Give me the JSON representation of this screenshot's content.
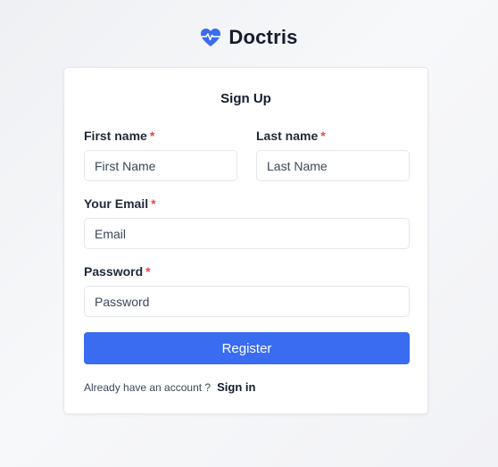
{
  "brand": {
    "name": "Doctris",
    "color": "#396cf0"
  },
  "form": {
    "title": "Sign Up",
    "required_mark": "*",
    "first_name": {
      "label": "First name",
      "placeholder": "First Name",
      "value": ""
    },
    "last_name": {
      "label": "Last name",
      "placeholder": "Last Name",
      "value": ""
    },
    "email": {
      "label": "Your Email",
      "placeholder": "Email",
      "value": ""
    },
    "password": {
      "label": "Password",
      "placeholder": "Password",
      "value": ""
    },
    "register_label": "Register",
    "footer": {
      "text": "Already have an account ?",
      "signin_label": "Sign in"
    }
  },
  "colors": {
    "primary": "#396cf0",
    "required": "#ef4444"
  },
  "icons": {
    "brand": "heart-pulse-icon"
  }
}
